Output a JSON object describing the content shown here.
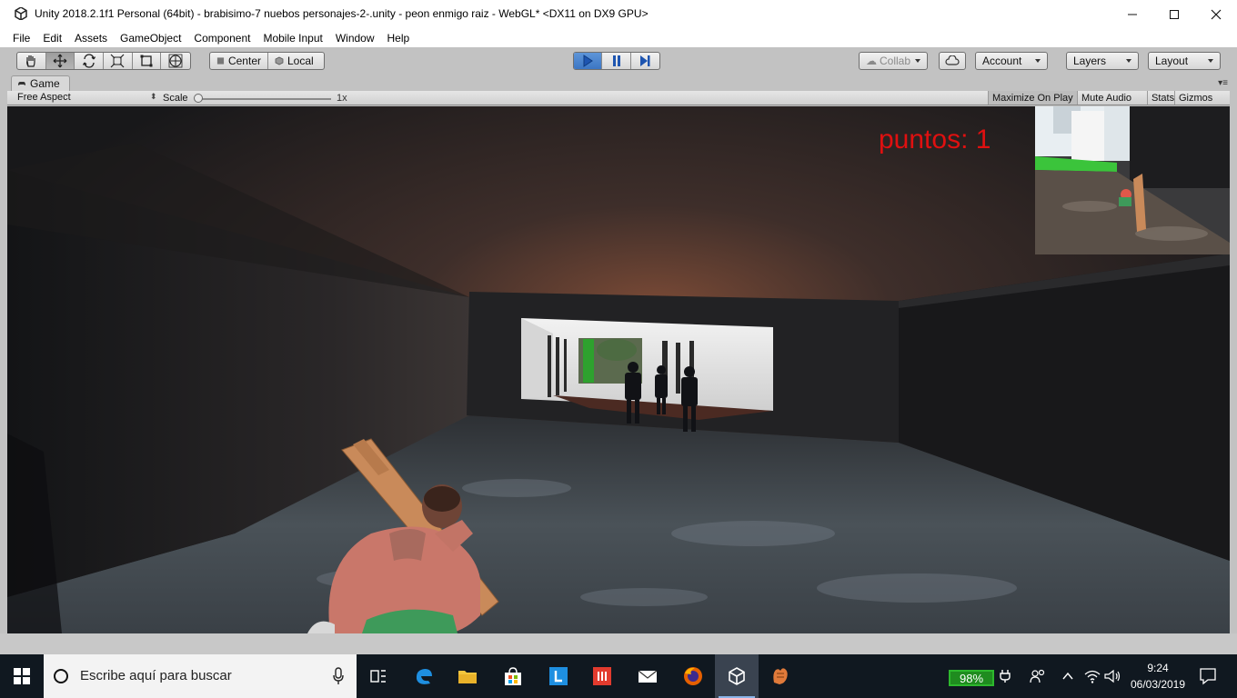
{
  "window": {
    "title": "Unity 2018.2.1f1 Personal (64bit) - brabisimo-7 nuebos personajes-2-.unity - peon enmigo raiz - WebGL* <DX11 on DX9 GPU>",
    "controls": {
      "minimize": "–",
      "maximize": "☐",
      "close": "✕"
    }
  },
  "menu": [
    "File",
    "Edit",
    "Assets",
    "GameObject",
    "Component",
    "Mobile Input",
    "Window",
    "Help"
  ],
  "toolbar": {
    "tools": [
      "hand-tool",
      "move-tool",
      "rotate-tool",
      "scale-tool",
      "rect-tool",
      "transform-tool"
    ],
    "active_tool": "move-tool",
    "pivot": {
      "center": "Center",
      "local": "Local"
    },
    "play_state": "playing",
    "collab": "Collab",
    "account": "Account",
    "layers": "Layers",
    "layout": "Layout"
  },
  "game_view": {
    "tab": "Game",
    "aspect": "Free Aspect",
    "scale_label": "Scale",
    "scale_value": "1x",
    "scale_fraction": 0.0,
    "toggles": [
      "Maximize On Play",
      "Mute Audio",
      "Stats",
      "Gizmos"
    ],
    "score_text": "puntos: 1"
  },
  "taskbar": {
    "search_placeholder": "Escribe aquí para buscar",
    "apps": [
      "task-view",
      "edge",
      "file-explorer",
      "store",
      "lync",
      "office",
      "mail",
      "firefox",
      "unity",
      "other"
    ],
    "active_app": "unity",
    "battery": "98%",
    "time": "9:24",
    "date": "06/03/2019"
  },
  "colors": {
    "editor_bg": "#c2c2c2",
    "play_blue": "#3c76c4",
    "score_red": "#e01010",
    "taskbar": "#101820",
    "battery_green": "#1f8c1f"
  }
}
